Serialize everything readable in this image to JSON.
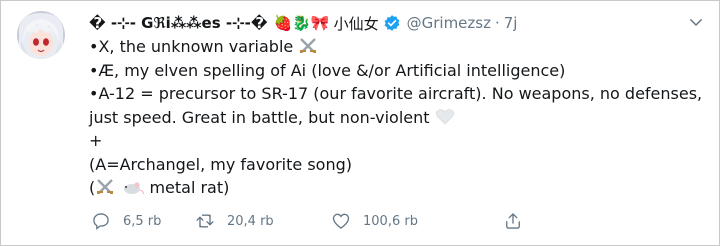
{
  "tweet": {
    "display_name": "� -⊹- Gℜі⁂⁂es -⊹-�",
    "name_emojis": "🍓🐉🎀",
    "name_cjk": "小仙女",
    "handle": "@Grimezsz",
    "separator": "·",
    "time": "7j",
    "lines": [
      "•X, the unknown variable",
      "•Æ, my elven spelling of Ai (love &/or Artificial intelligence)",
      "•A-12 = precursor to SR-17 (our favorite aircraft).  No weapons, no defenses,",
      "just speed.  Great in battle, but non-violent",
      "+",
      "(A=Archangel, my favorite song)",
      "(",
      "metal rat)"
    ]
  },
  "actions": {
    "reply_count": "6,5 rb",
    "retweet_count": "20,4 rb",
    "like_count": "100,6 rb"
  },
  "colors": {
    "text": "#14171a",
    "muted": "#657786",
    "verified": "#1da1f2"
  },
  "icons": [
    "avatar",
    "strawberry-icon",
    "dragon-icon",
    "ribbon-icon",
    "verified-badge-icon",
    "chevron-down-icon",
    "crossed-swords-icon",
    "white-heart-icon",
    "mouse-icon",
    "reply-icon",
    "retweet-icon",
    "like-icon",
    "share-icon"
  ]
}
